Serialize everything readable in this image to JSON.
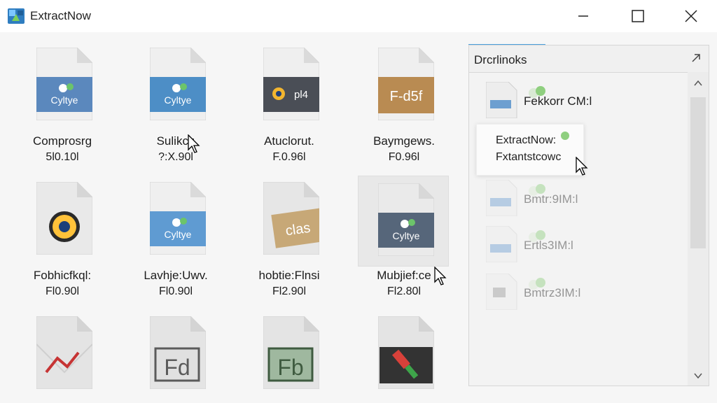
{
  "window": {
    "title": "ExtractNow",
    "icon": "extractnow-app-icon",
    "controls": {
      "minimize": "minimize-icon",
      "maximize": "maximize-icon",
      "close": "close-icon"
    }
  },
  "files": [
    {
      "name": "Comprosrg",
      "size": "5l0.10l",
      "badge": "Cyltye",
      "badge_color": "#5b88bd",
      "icon": "archive-icon"
    },
    {
      "name": "Sulikct:",
      "size": "?:X.90l",
      "badge": "Cyltye",
      "badge_color": "#4d8ec6",
      "icon": "archive-icon"
    },
    {
      "name": "Atuclorut.",
      "size": "F.0.96l",
      "badge": "pl4",
      "badge_color": "#4a4e56",
      "icon": "disk-image-icon"
    },
    {
      "name": "Baymgews.",
      "size": "F0.96l",
      "badge": "F-d5f",
      "badge_color": "#b98b52",
      "icon": "pdf-archive-icon"
    },
    {
      "name": "Fobhicfkql:",
      "size": "Fl0.90l",
      "badge": "",
      "badge_color": "#ffc23a",
      "icon": "media-disc-icon"
    },
    {
      "name": "Lavhje:Uwv.",
      "size": "Fl0.90l",
      "badge": "Cyltye",
      "badge_color": "#5f9bd2",
      "icon": "archive-icon"
    },
    {
      "name": "hobtie:Flnsi",
      "size": "Fl2.90l",
      "badge": "clas",
      "badge_color": "#c7a877",
      "icon": "class-file-icon"
    },
    {
      "name": "Mubjief:ce",
      "size": "Fl2.80l",
      "badge": "Cyltye",
      "badge_color": "#56667a",
      "icon": "archive-icon"
    },
    {
      "name": "",
      "size": "",
      "badge": "",
      "badge_color": "#c63434",
      "icon": "broken-archive-icon"
    },
    {
      "name": "",
      "size": "",
      "badge": "Fd",
      "badge_color": "#5b5b5b",
      "icon": "font-file-icon"
    },
    {
      "name": "",
      "size": "",
      "badge": "Fb",
      "badge_color": "#3f5b40",
      "icon": "font-file-icon"
    },
    {
      "name": "",
      "size": "",
      "badge": "",
      "badge_color": "#333333",
      "icon": "tool-icon"
    }
  ],
  "panel": {
    "title": "Drcrlinoks",
    "items": [
      {
        "label": "Fekkorr CM:l",
        "faded": false
      },
      {
        "label": "Bmtr:9IM:l",
        "faded": true
      },
      {
        "label": "Ertls3IM:l",
        "faded": true
      },
      {
        "label": "Bmtrz3IM:l",
        "faded": true
      }
    ]
  },
  "tooltip": {
    "title": "ExtractNow:",
    "subtitle": "Fxtantstcowc"
  },
  "colors": {
    "accent": "#4aa0dc",
    "window_bg": "#f6f6f6"
  }
}
